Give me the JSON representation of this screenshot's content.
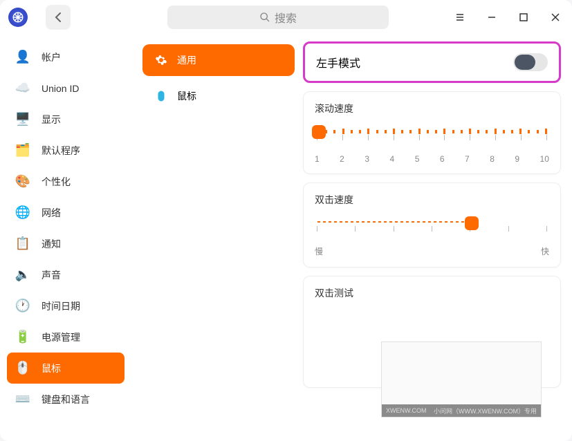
{
  "header": {
    "search_placeholder": "搜索"
  },
  "sidebar": {
    "items": [
      {
        "label": "帐户",
        "icon": "👤",
        "bg": "transparent"
      },
      {
        "label": "Union ID",
        "icon": "☁️",
        "bg": "transparent"
      },
      {
        "label": "显示",
        "icon": "🖥️",
        "bg": "transparent"
      },
      {
        "label": "默认程序",
        "icon": "🗂️",
        "bg": "transparent"
      },
      {
        "label": "个性化",
        "icon": "🎨",
        "bg": "transparent"
      },
      {
        "label": "网络",
        "icon": "🌐",
        "bg": "transparent"
      },
      {
        "label": "通知",
        "icon": "📋",
        "bg": "transparent"
      },
      {
        "label": "声音",
        "icon": "🔈",
        "bg": "transparent"
      },
      {
        "label": "时间日期",
        "icon": "🕐",
        "bg": "transparent"
      },
      {
        "label": "电源管理",
        "icon": "🔋",
        "bg": "transparent"
      },
      {
        "label": "鼠标",
        "icon": "🖱️",
        "bg": "transparent",
        "active": true
      },
      {
        "label": "键盘和语言",
        "icon": "⌨️",
        "bg": "transparent"
      }
    ]
  },
  "tabs": [
    {
      "label": "通用",
      "active": true,
      "icon": "gear"
    },
    {
      "label": "鼠标",
      "active": false,
      "icon": "mouse"
    }
  ],
  "settings": {
    "left_hand_mode": {
      "label": "左手模式",
      "value": false
    },
    "scroll_speed": {
      "label": "滚动速度",
      "min": 1,
      "max": 10,
      "value": 1,
      "ticks": [
        "1",
        "2",
        "3",
        "4",
        "5",
        "6",
        "7",
        "8",
        "9",
        "10"
      ]
    },
    "double_click_speed": {
      "label": "双击速度",
      "min_label": "慢",
      "max_label": "快",
      "value": 0.65
    },
    "double_click_test": {
      "label": "双击测试"
    }
  },
  "watermark": {
    "left_text": "XWENW.COM",
    "right_text": "小问网（WWW.XWENW.COM）专用"
  }
}
